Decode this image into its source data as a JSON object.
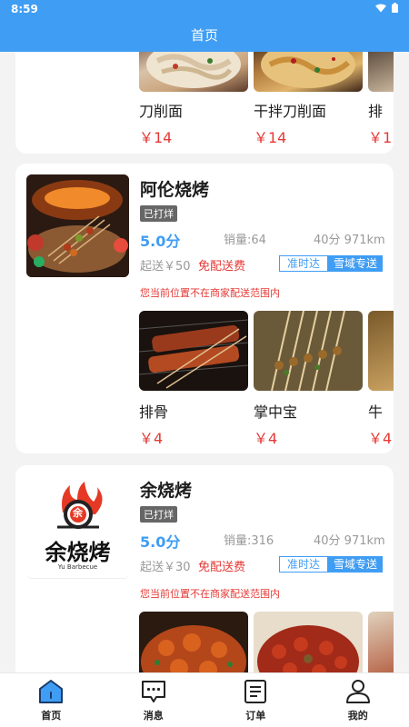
{
  "status": {
    "time": "8:59",
    "wifi_icon": "wifi-icon",
    "battery_icon": "battery-icon"
  },
  "header": {
    "title": "首页"
  },
  "colors": {
    "accent": "#3f9df4",
    "price": "#e53935",
    "badge": "#666666"
  },
  "card_top": {
    "dishes": [
      {
        "name": "刀削面",
        "price": "￥14"
      },
      {
        "name": "干拌刀削面",
        "price": "￥14"
      },
      {
        "name": "排",
        "price": "￥1"
      }
    ]
  },
  "shops": [
    {
      "name": "阿伦烧烤",
      "badge": "已打烊",
      "rating": "5.0分",
      "sales": "销量:64",
      "distance": "40分 971km",
      "min_price": "起送￥50",
      "delivery_fee": "免配送费",
      "tag_ontime": "准时达",
      "tag_courier": "雪域专送",
      "notice": "您当前位置不在商家配送范围内",
      "dishes": [
        {
          "name": "排骨",
          "price": "￥4"
        },
        {
          "name": "掌中宝",
          "price": "￥4"
        },
        {
          "name": "牛",
          "price": "￥4"
        }
      ]
    },
    {
      "name": "余烧烤",
      "badge": "已打烊",
      "rating": "5.0分",
      "sales": "销量:316",
      "distance": "40分 971km",
      "min_price": "起送￥30",
      "delivery_fee": "免配送费",
      "tag_ontime": "准时达",
      "tag_courier": "雪域专送",
      "notice": "您当前位置不在商家配送范围内",
      "logo_text": "余烧烤",
      "logo_sub": "Yu Barbecue",
      "logo_char": "余"
    }
  ],
  "nav": [
    {
      "label": "首页",
      "icon": "home-icon"
    },
    {
      "label": "消息",
      "icon": "message-icon"
    },
    {
      "label": "订单",
      "icon": "order-icon"
    },
    {
      "label": "我的",
      "icon": "profile-icon"
    }
  ]
}
